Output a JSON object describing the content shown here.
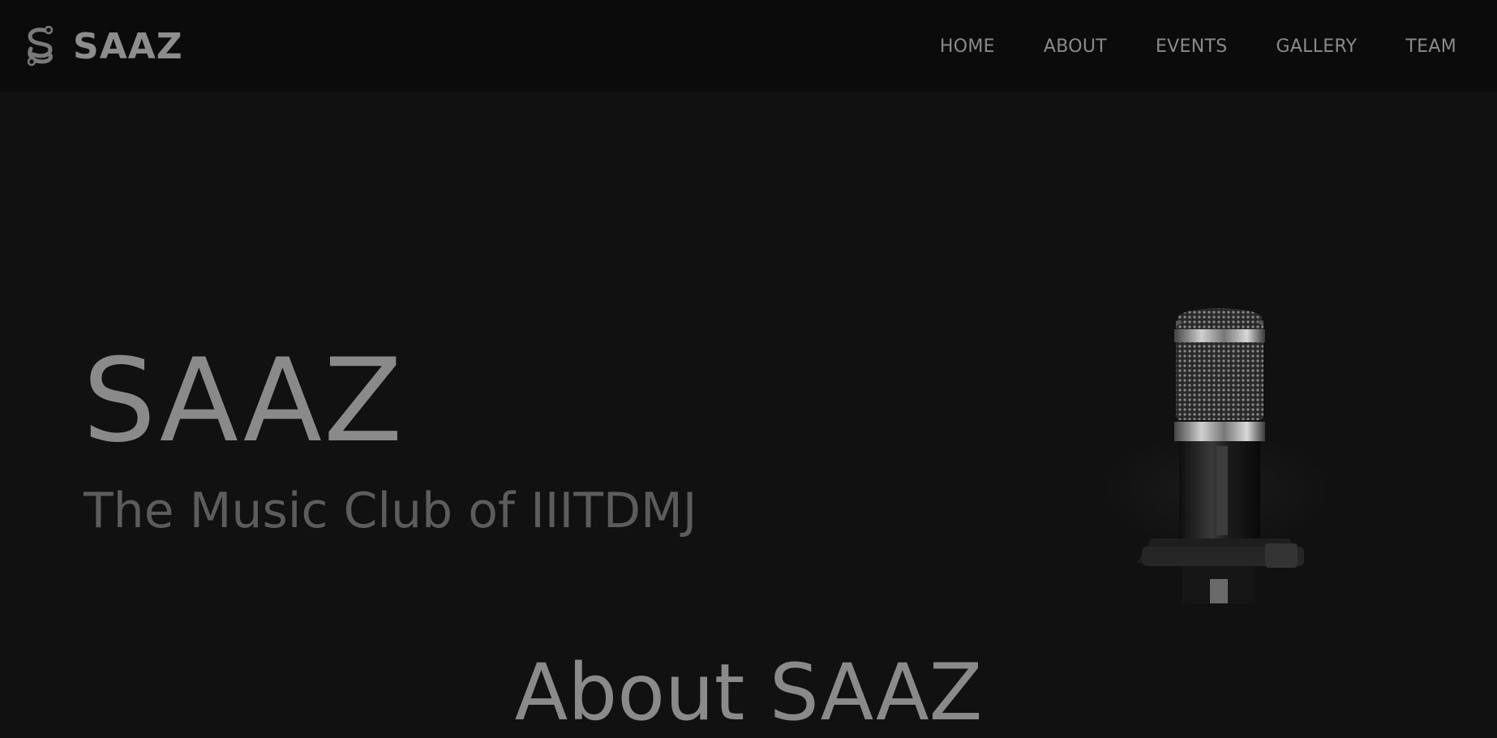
{
  "navbar": {
    "brand_name": "SAAZ",
    "logo_icon": "saaz-s-logo-icon",
    "links": [
      {
        "label": "HOME"
      },
      {
        "label": "ABOUT"
      },
      {
        "label": "EVENTS"
      },
      {
        "label": "GALLERY"
      },
      {
        "label": "TEAM"
      }
    ]
  },
  "hero": {
    "title": "SAAZ",
    "subtitle": "The Music Club of IIITDMJ",
    "image": "microphone-image"
  },
  "about": {
    "heading": "About SAAZ"
  },
  "colors": {
    "page_background": "#111111",
    "navbar_background": "#0b0b0b",
    "text_primary": "#8a8a8a",
    "text_secondary": "#5c5c5c"
  }
}
